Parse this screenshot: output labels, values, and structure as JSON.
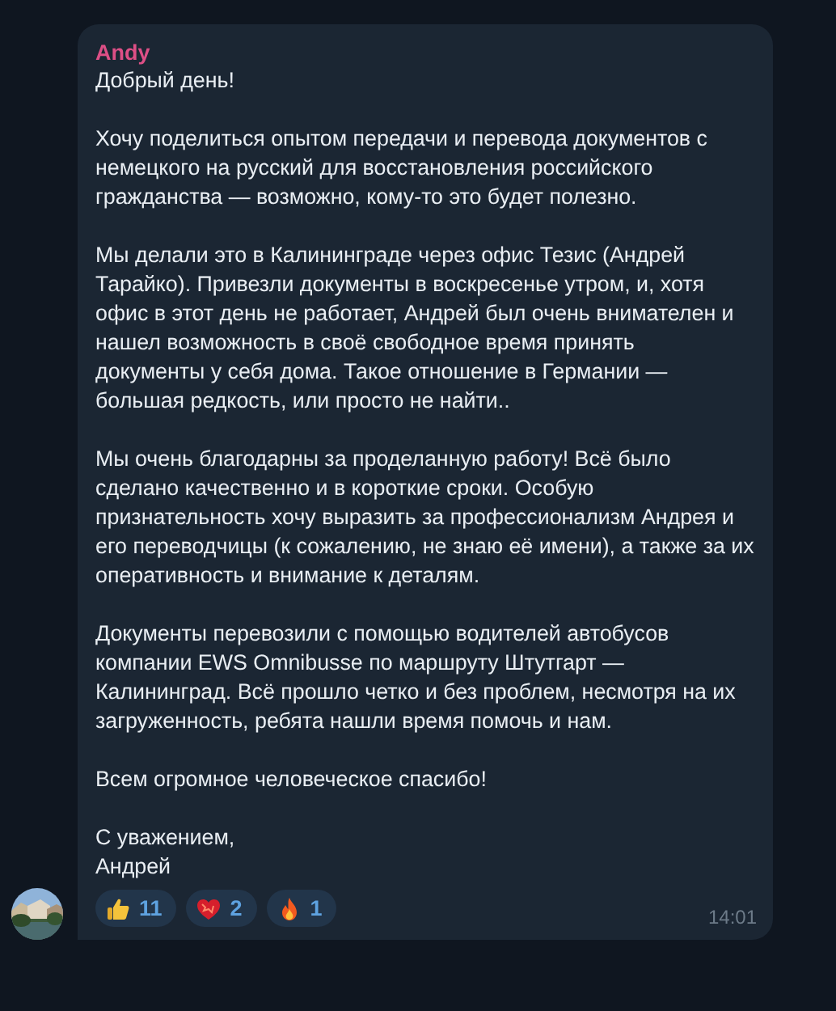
{
  "message": {
    "author": "Andy",
    "time": "14:01",
    "paragraphs": [
      [
        "Добрый день!"
      ],
      [
        "Хочу поделиться опытом передачи и перевода документов с",
        "немецкого на русский для восстановления российского",
        "гражданства — возможно, кому-то это будет полезно."
      ],
      [
        "Мы делали это в Калининграде через офис Тезис (Андрей",
        "Тарайко). Привезли документы в воскресенье утром, и, хотя",
        "офис в этот день не работает, Андрей был очень внимателен и",
        "нашел возможность в своё свободное время принять",
        "документы у себя дома. Такое отношение в Германии —",
        "большая редкость, или просто не найти.."
      ],
      [
        "Мы очень благодарны за проделанную работу! Всё было",
        "сделано качественно и в короткие сроки. Особую",
        "признательность хочу выразить за профессионализм Андрея и",
        "его переводчицы (к сожалению, не знаю её имени), а также за их",
        "оперативность и внимание к деталям."
      ],
      [
        "Документы перевозили с помощью водителей автобусов",
        "компании EWS Omnibusse по маршруту Штутгарт —",
        "Калининград. Всё прошло четко и без проблем, несмотря на их",
        "загруженность, ребята нашли время помочь и нам."
      ],
      [
        "Всем огромное человеческое спасибо!"
      ],
      [
        "С уважением,",
        "Андрей"
      ]
    ],
    "reactions": [
      {
        "kind": "thumbs-up",
        "count": "11"
      },
      {
        "kind": "heart",
        "count": "2"
      },
      {
        "kind": "fire",
        "count": "1"
      }
    ]
  }
}
